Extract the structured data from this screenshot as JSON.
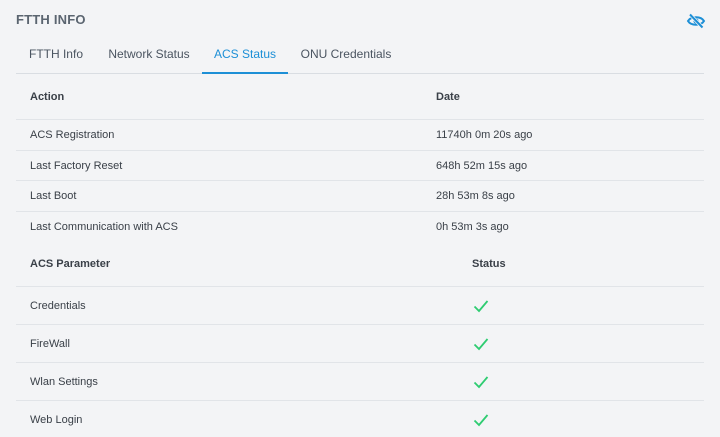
{
  "panel": {
    "title": "FTTH INFO",
    "toggle_icon": "eye-off-icon",
    "accent": "#1d8fd6"
  },
  "tabs": [
    {
      "label": "FTTH Info",
      "active": false
    },
    {
      "label": "Network Status",
      "active": false
    },
    {
      "label": "ACS Status",
      "active": true
    },
    {
      "label": "ONU Credentials",
      "active": false
    }
  ],
  "acs_table": {
    "headers": {
      "action": "Action",
      "date": "Date"
    },
    "rows": [
      {
        "action": "ACS Registration",
        "date": "11740h 0m 20s ago"
      },
      {
        "action": "Last Factory Reset",
        "date": "648h 52m 15s ago"
      },
      {
        "action": "Last Boot",
        "date": "28h 53m 8s ago"
      },
      {
        "action": "Last Communication with ACS",
        "date": "0h 53m 3s ago"
      }
    ]
  },
  "param_table": {
    "headers": {
      "parameter": "ACS Parameter",
      "status": "Status"
    },
    "rows": [
      {
        "parameter": "Credentials",
        "status_icon": "check-icon",
        "status_color": "#2ecc71"
      },
      {
        "parameter": "FireWall",
        "status_icon": "check-icon",
        "status_color": "#2ecc71"
      },
      {
        "parameter": "Wlan Settings",
        "status_icon": "check-icon",
        "status_color": "#2ecc71"
      },
      {
        "parameter": "Web Login",
        "status_icon": "check-icon",
        "status_color": "#2ecc71"
      }
    ]
  }
}
